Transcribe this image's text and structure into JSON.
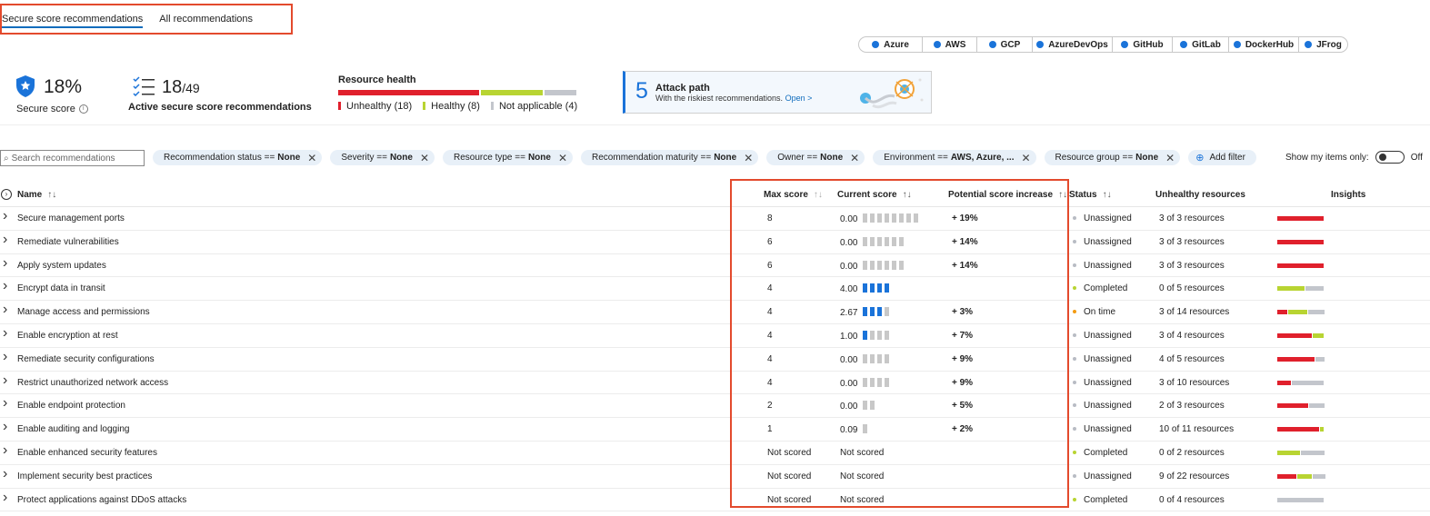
{
  "tabs": [
    {
      "label": "Secure score recommendations",
      "active": true
    },
    {
      "label": "All recommendations",
      "active": false
    }
  ],
  "environments": [
    {
      "label": "Azure",
      "w": 70
    },
    {
      "label": "AWS",
      "w": 60
    },
    {
      "label": "GCP",
      "w": 61
    },
    {
      "label": "AzureDevOps",
      "w": 88
    },
    {
      "label": "GitHub",
      "w": 66
    },
    {
      "label": "GitLab",
      "w": 62
    },
    {
      "label": "DockerHub",
      "w": 77
    },
    {
      "label": "JFrog",
      "w": 55
    }
  ],
  "summary": {
    "secure_score": "18%",
    "secure_score_label": "Secure score",
    "active_count": "18",
    "active_total": "/49",
    "active_label": "Active secure score recommendations",
    "resource_health_title": "Resource health",
    "resource_health": {
      "unhealthy": 18,
      "healthy": 8,
      "not_applicable": 4,
      "unhealthy_label": "Unhealthy (18)",
      "healthy_label": "Healthy (8)",
      "na_label": "Not applicable (4)",
      "unhealthy_color": "#e0202c",
      "healthy_color": "#b8d432",
      "na_color": "#c3c6cc"
    },
    "attack_path": {
      "count": "5",
      "title": "Attack path",
      "subtitle": "With the riskiest recommendations.",
      "link": "Open >"
    }
  },
  "search": {
    "placeholder": "Search recommendations",
    "icon": "search-icon"
  },
  "filters": [
    {
      "key": "Recommendation status ==",
      "value": "None"
    },
    {
      "key": "Severity ==",
      "value": "None"
    },
    {
      "key": "Resource type ==",
      "value": "None"
    },
    {
      "key": "Recommendation maturity ==",
      "value": "None"
    },
    {
      "key": "Owner ==",
      "value": "None"
    },
    {
      "key": "Environment ==",
      "value": "AWS, Azure, ..."
    },
    {
      "key": "Resource group ==",
      "value": "None"
    }
  ],
  "add_filter_label": "Add filter",
  "my_items": {
    "label": "Show my items only:",
    "state": "Off"
  },
  "columns": {
    "name": "Name",
    "max_score": "Max score",
    "current_score": "Current score",
    "potential": "Potential score increase",
    "status": "Status",
    "unhealthy": "Unhealthy resources",
    "insights": "Insights"
  },
  "rows": [
    {
      "name": "Secure management ports",
      "max": "8",
      "current": "0.00",
      "bars": 8,
      "filled": 0,
      "potential": "+ 19%",
      "status": "Unassigned",
      "status_color": "#b8bcc4",
      "unhealthy": "3 of 3 resources",
      "insight": [
        {
          "color": "#e0202c",
          "w": 51
        }
      ]
    },
    {
      "name": "Remediate vulnerabilities",
      "max": "6",
      "current": "0.00",
      "bars": 6,
      "filled": 0,
      "potential": "+ 14%",
      "status": "Unassigned",
      "status_color": "#b8bcc4",
      "unhealthy": "3 of 3 resources",
      "insight": [
        {
          "color": "#e0202c",
          "w": 51
        }
      ]
    },
    {
      "name": "Apply system updates",
      "max": "6",
      "current": "0.00",
      "bars": 6,
      "filled": 0,
      "potential": "+ 14%",
      "status": "Unassigned",
      "status_color": "#b8bcc4",
      "unhealthy": "3 of 3 resources",
      "insight": [
        {
          "color": "#e0202c",
          "w": 51
        }
      ]
    },
    {
      "name": "Encrypt data in transit",
      "max": "4",
      "current": "4.00",
      "bars": 4,
      "filled": 4,
      "potential": "",
      "status": "Completed",
      "status_color": "#b8d432",
      "unhealthy": "0 of 5 resources",
      "insight": [
        {
          "color": "#b8d432",
          "w": 30
        },
        {
          "color": "#c3c6cc",
          "w": 20
        }
      ]
    },
    {
      "name": "Manage access and permissions",
      "max": "4",
      "current": "2.67",
      "bars": 4,
      "filled": 3,
      "potential": "+ 3%",
      "status": "On time",
      "status_color": "#f39c12",
      "unhealthy": "3 of 14 resources",
      "insight": [
        {
          "color": "#e0202c",
          "w": 11
        },
        {
          "color": "#b8d432",
          "w": 21
        },
        {
          "color": "#c3c6cc",
          "w": 18
        }
      ]
    },
    {
      "name": "Enable encryption at rest",
      "max": "4",
      "current": "1.00",
      "bars": 4,
      "filled": 1,
      "potential": "+ 7%",
      "status": "Unassigned",
      "status_color": "#b8bcc4",
      "unhealthy": "3 of 4 resources",
      "insight": [
        {
          "color": "#e0202c",
          "w": 38
        },
        {
          "color": "#b8d432",
          "w": 12
        }
      ]
    },
    {
      "name": "Remediate security configurations",
      "max": "4",
      "current": "0.00",
      "bars": 4,
      "filled": 0,
      "potential": "+ 9%",
      "status": "Unassigned",
      "status_color": "#b8bcc4",
      "unhealthy": "4 of 5 resources",
      "insight": [
        {
          "color": "#e0202c",
          "w": 41
        },
        {
          "color": "#c3c6cc",
          "w": 10
        }
      ]
    },
    {
      "name": "Restrict unauthorized network access",
      "max": "4",
      "current": "0.00",
      "bars": 4,
      "filled": 0,
      "potential": "+ 9%",
      "status": "Unassigned",
      "status_color": "#b8bcc4",
      "unhealthy": "3 of 10 resources",
      "insight": [
        {
          "color": "#e0202c",
          "w": 15
        },
        {
          "color": "#c3c6cc",
          "w": 35
        }
      ]
    },
    {
      "name": "Enable endpoint protection",
      "max": "2",
      "current": "0.00",
      "bars": 2,
      "filled": 0,
      "potential": "+ 5%",
      "status": "Unassigned",
      "status_color": "#b8bcc4",
      "unhealthy": "2 of 3 resources",
      "insight": [
        {
          "color": "#e0202c",
          "w": 34
        },
        {
          "color": "#c3c6cc",
          "w": 17
        }
      ]
    },
    {
      "name": "Enable auditing and logging",
      "max": "1",
      "current": "0.09",
      "bars": 1,
      "filled": 0,
      "potential": "+ 2%",
      "status": "Unassigned",
      "status_color": "#b8bcc4",
      "unhealthy": "10 of 11 resources",
      "insight": [
        {
          "color": "#e0202c",
          "w": 46
        },
        {
          "color": "#b8d432",
          "w": 4
        }
      ]
    },
    {
      "name": "Enable enhanced security features",
      "max": "Not scored",
      "current": "Not scored",
      "bars": 0,
      "filled": 0,
      "potential": "",
      "status": "Completed",
      "status_color": "#b8d432",
      "unhealthy": "0 of 2 resources",
      "insight": [
        {
          "color": "#b8d432",
          "w": 25
        },
        {
          "color": "#c3c6cc",
          "w": 26
        }
      ]
    },
    {
      "name": "Implement security best practices",
      "max": "Not scored",
      "current": "Not scored",
      "bars": 0,
      "filled": 0,
      "potential": "",
      "status": "Unassigned",
      "status_color": "#b8bcc4",
      "unhealthy": "9 of 22 resources",
      "insight": [
        {
          "color": "#e0202c",
          "w": 21
        },
        {
          "color": "#b8d432",
          "w": 16
        },
        {
          "color": "#c3c6cc",
          "w": 14
        }
      ]
    },
    {
      "name": "Protect applications against DDoS attacks",
      "max": "Not scored",
      "current": "Not scored",
      "bars": 0,
      "filled": 0,
      "potential": "",
      "status": "Completed",
      "status_color": "#b8d432",
      "unhealthy": "0 of 4 resources",
      "insight": [
        {
          "color": "#c3c6cc",
          "w": 51
        }
      ]
    }
  ],
  "colors": {
    "accent": "#0f6cbd",
    "highlight": "#e34a2d"
  }
}
